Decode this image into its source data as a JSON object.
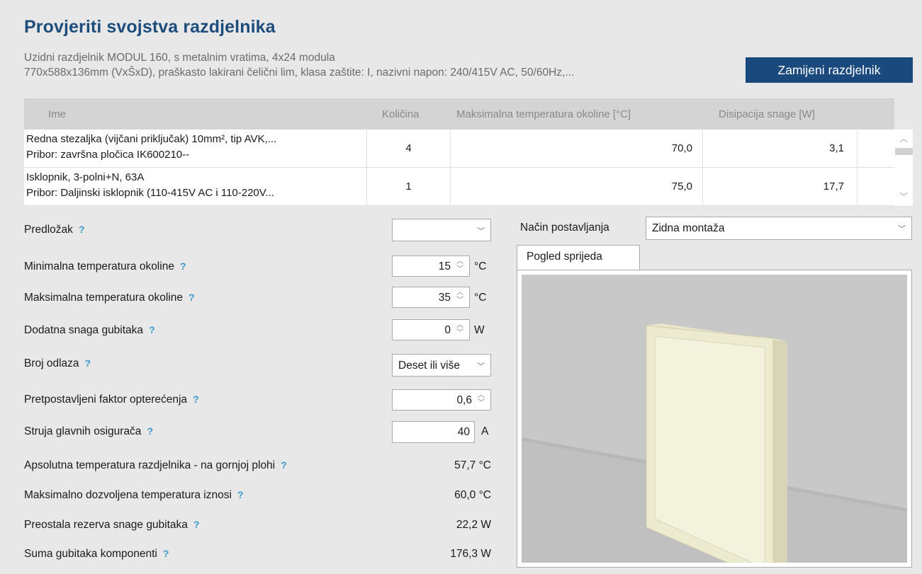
{
  "page": {
    "title": "Provjeriti svojstva razdjelnika",
    "description_line1": "Uzidni razdjelnik MODUL 160, s metalnim vratima, 4x24 modula",
    "description_line2": "770x588x136mm (VxŠxD), praškasto lakirani čelični lim, klasa zaštite: I, nazivni napon: 240/415V AC, 50/60Hz,...",
    "replace_button": "Zamijeni razdjelnik"
  },
  "table": {
    "headers": {
      "name": "Ime",
      "quantity": "Količina",
      "max_temp": "Maksimalna temperatura okoline [°C]",
      "dissipation": "Disipacija snage [W]"
    },
    "rows": [
      {
        "name_line1": "Redna stezaljka (vijčani priključak) 10mm², tip AVK,...",
        "name_line2": "Pribor: završna pločica IK600210--",
        "quantity": "4",
        "max_temp": "70,0",
        "dissipation": "3,1"
      },
      {
        "name_line1": "Isklopnik, 3-polni+N, 63A",
        "name_line2": "Pribor: Daljinski isklopnik (110-415V AC i 110-220V...",
        "quantity": "1",
        "max_temp": "75,0",
        "dissipation": "17,7"
      }
    ]
  },
  "form": {
    "help_glyph": "?",
    "template": {
      "label": "Predložak",
      "value": ""
    },
    "min_temp": {
      "label": "Minimalna temperatura okoline",
      "value": "15",
      "unit": "°C"
    },
    "max_temp": {
      "label": "Maksimalna temperatura okoline",
      "value": "35",
      "unit": "°C"
    },
    "extra_loss": {
      "label": "Dodatna snaga gubitaka",
      "value": "0",
      "unit": "W"
    },
    "outgoing": {
      "label": "Broj odlaza",
      "value": "Deset ili više"
    },
    "load_factor": {
      "label": "Pretpostavljeni faktor opterećenja",
      "value": "0,6"
    },
    "main_fuse": {
      "label": "Struja glavnih osigurača",
      "value": "40",
      "unit": "A"
    },
    "abs_temp": {
      "label": "Apsolutna temperatura razdjelnika - na gornjoj plohi",
      "value": "57,7 °C"
    },
    "max_allowed": {
      "label": "Maksimalno dozvoljena temperatura iznosi",
      "value": "60,0 °C"
    },
    "reserve": {
      "label": "Preostala rezerva snage gubitaka",
      "value": "22,2 W"
    },
    "sum_losses": {
      "label": "Suma gubitaka komponenti",
      "value": "176,3 W"
    }
  },
  "view": {
    "mounting_label": "Način postavljanja",
    "mounting_value": "Zidna montaža",
    "tab_front": "Pogled sprijeda"
  },
  "colors": {
    "title": "#1c4d7c",
    "accent_button": "#1a4a7d",
    "help": "#3a97c9"
  }
}
